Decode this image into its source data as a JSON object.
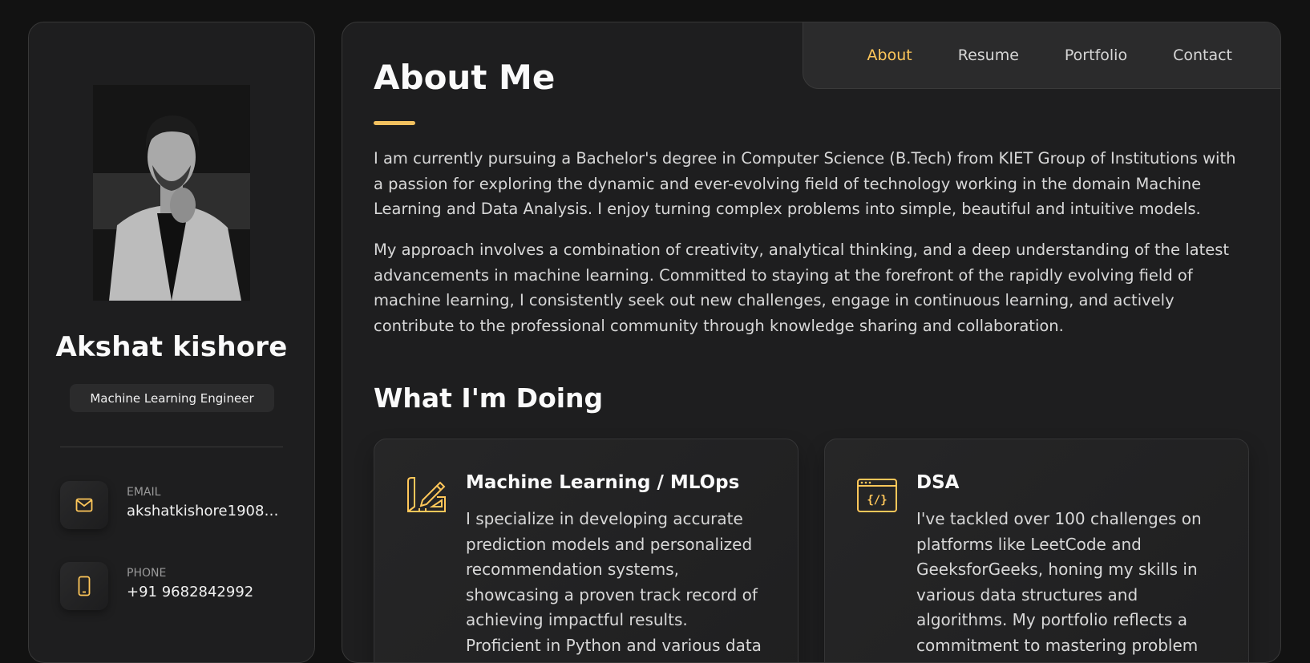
{
  "sidebar": {
    "name": "Akshat kishore",
    "title": "Machine Learning Engineer",
    "contacts": [
      {
        "label": "Email",
        "value": "akshatkishore1908@...",
        "icon": "mail-icon"
      },
      {
        "label": "Phone",
        "value": "+91 9682842992",
        "icon": "phone-icon"
      }
    ]
  },
  "nav": {
    "items": [
      {
        "label": "About",
        "active": true
      },
      {
        "label": "Resume",
        "active": false
      },
      {
        "label": "Portfolio",
        "active": false
      },
      {
        "label": "Contact",
        "active": false
      }
    ]
  },
  "about": {
    "heading": "About Me",
    "paragraphs": [
      "I am currently pursuing a Bachelor's degree in Computer Science (B.Tech) from KIET Group of Institutions with a passion for exploring the dynamic and ever-evolving field of technology working in the domain Machine Learning and Data Analysis. I enjoy turning complex problems into simple, beautiful and intuitive models.",
      "My approach involves a combination of creativity, analytical thinking, and a deep understanding of the latest advancements in machine learning. Committed to staying at the forefront of the rapidly evolving field of machine learning, I consistently seek out new challenges, engage in continuous learning, and actively contribute to the professional community through knowledge sharing and collaboration."
    ]
  },
  "doing": {
    "heading": "What I'm Doing",
    "services": [
      {
        "title": "Machine Learning / MLOps",
        "icon": "design-pencil-ruler-icon",
        "description": "I specialize in developing accurate prediction models and personalized recommendation systems, showcasing a proven track record of achieving impactful results. Proficient in Python and various data science"
      },
      {
        "title": "DSA",
        "icon": "code-window-icon",
        "description": "I've tackled over 100 challenges on platforms like LeetCode and GeeksforGeeks, honing my skills in various data structures and algorithms. My portfolio reflects a commitment to mastering problem"
      }
    ]
  },
  "colors": {
    "accent": "#ffc75a",
    "background": "#121212",
    "panel": "#1e1e1f"
  }
}
